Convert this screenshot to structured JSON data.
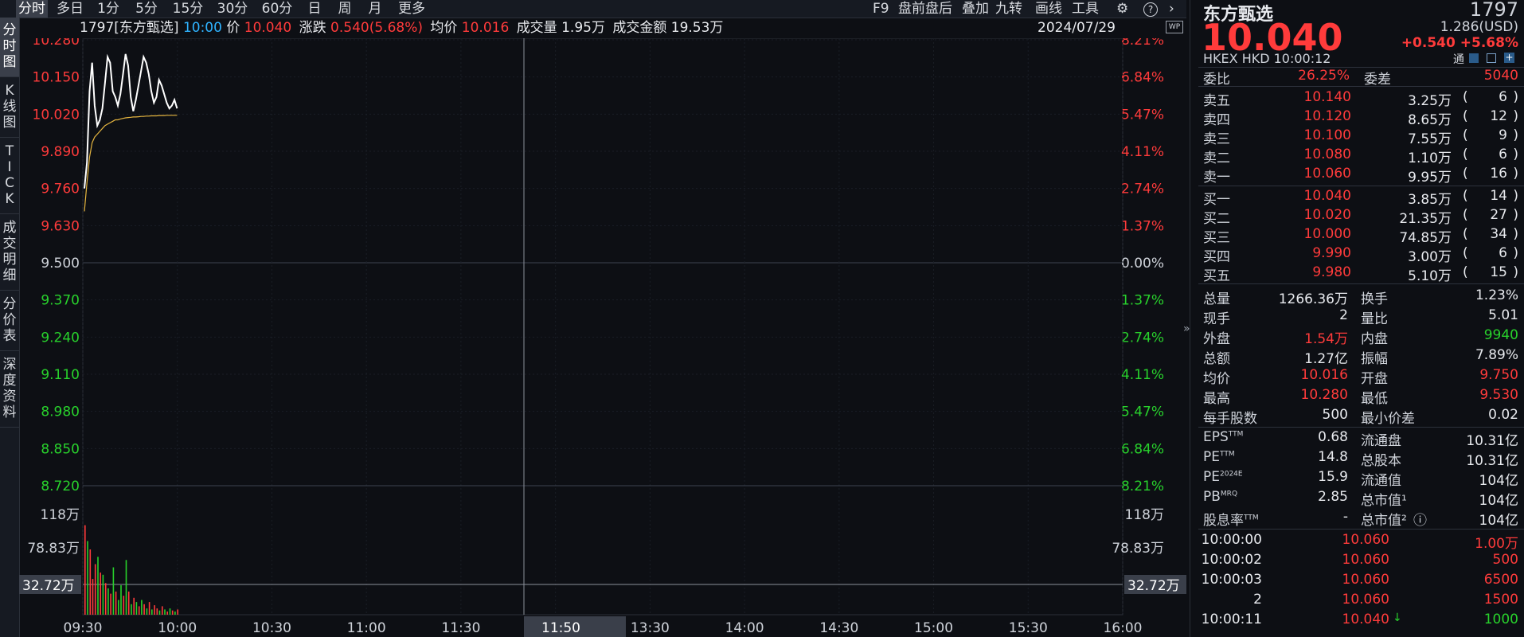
{
  "toolbar": {
    "left_tabs": [
      "分时",
      "多日",
      "1分",
      "5分",
      "15分",
      "30分",
      "60分",
      "日",
      "周",
      "月",
      "更多"
    ],
    "active_tab": "分时",
    "right_items": [
      "F9",
      "盘前盘后",
      "叠加",
      "九转",
      "画线",
      "工具"
    ],
    "gear_icon": "gear-icon",
    "help_icon": "help-icon",
    "expand_icon": "chevron-right-icon"
  },
  "side_tabs": [
    "分时图",
    "K线图",
    "TICK",
    "成交明细",
    "分价表",
    "深度资料"
  ],
  "info_bar": {
    "code_name": "1797[东方甄选]",
    "time": "10:00",
    "price_label": "价",
    "price": "10.040",
    "change_label": "涨跌",
    "change": "0.540(5.68%)",
    "avg_label": "均价",
    "avg": "10.016",
    "vol_label": "成交量",
    "vol": "1.95万",
    "amount_label": "成交金额",
    "amount": "19.53万",
    "date": "2024/07/29",
    "wp_badge": "WP"
  },
  "chart_data": {
    "type": "line",
    "x_ticks": [
      "09:30",
      "10:00",
      "10:30",
      "11:00",
      "11:30",
      "11:50",
      "13:30",
      "14:00",
      "14:30",
      "15:00",
      "15:30",
      "16:00"
    ],
    "price_ticks": [
      "10.280",
      "10.150",
      "10.020",
      "9.890",
      "9.760",
      "9.630",
      "9.500",
      "9.370",
      "9.240",
      "9.110",
      "8.980",
      "8.850",
      "8.720"
    ],
    "pct_ticks": [
      "8.21%",
      "6.84%",
      "5.47%",
      "4.11%",
      "2.74%",
      "1.37%",
      "0.00%",
      "1.37%",
      "2.74%",
      "4.11%",
      "5.47%",
      "6.84%",
      "8.21%"
    ],
    "prev_close": 9.5,
    "ylim": [
      8.72,
      10.28
    ],
    "vol_ticks": [
      "118万",
      "78.83万",
      "32.72万"
    ],
    "cursor_time_label": "11:50",
    "cursor_vol_label": "32.72万",
    "series": [
      {
        "name": "price",
        "color": "#ffffff",
        "values": [
          9.76,
          9.85,
          10.1,
          10.2,
          10.05,
          9.98,
          10.0,
          10.04,
          10.13,
          10.22,
          10.2,
          10.1,
          10.08,
          10.05,
          10.09,
          10.16,
          10.23,
          10.19,
          10.08,
          10.03,
          10.07,
          10.12,
          10.17,
          10.22,
          10.2,
          10.16,
          10.1,
          10.06,
          10.08,
          10.14,
          10.12,
          10.09,
          10.06,
          10.04,
          10.05,
          10.07,
          10.04
        ]
      },
      {
        "name": "avg",
        "color": "#e6b640",
        "values": [
          9.68,
          9.78,
          9.87,
          9.92,
          9.94,
          9.95,
          9.96,
          9.97,
          9.98,
          9.985,
          9.99,
          9.995,
          10.0,
          10.0,
          10.003,
          10.005,
          10.007,
          10.008,
          10.009,
          10.01,
          10.01,
          10.011,
          10.012,
          10.012,
          10.013,
          10.013,
          10.014,
          10.014,
          10.014,
          10.015,
          10.015,
          10.015,
          10.016,
          10.016,
          10.016,
          10.016,
          10.016
        ]
      }
    ],
    "volume": {
      "max": 118,
      "values": [
        85,
        70,
        62,
        34,
        48,
        55,
        40,
        38,
        30,
        25,
        20,
        45,
        22,
        14,
        28,
        18,
        52,
        22,
        10,
        16,
        12,
        8,
        14,
        10,
        6,
        12,
        5,
        9,
        6,
        4,
        8,
        5,
        3,
        6,
        4,
        3,
        5
      ],
      "up": [
        false,
        true,
        false,
        false,
        false,
        true,
        false,
        true,
        false,
        true,
        false,
        true,
        false,
        true,
        true,
        false,
        true,
        false,
        true,
        false,
        true,
        false,
        true,
        false,
        true,
        false,
        true,
        false,
        false,
        true,
        false,
        true,
        false,
        true,
        false,
        true,
        false
      ]
    }
  },
  "quote": {
    "name": "东方甄选",
    "code": "1797",
    "price": "10.040",
    "usd": "1.286(USD)",
    "change": "+0.540",
    "change_pct": "+5.68%",
    "market": "HKEX",
    "currency": "HKD",
    "time": "10:00:12",
    "tong": "通",
    "ratio_label": "委比",
    "ratio": "26.25%",
    "diff_label": "委差",
    "diff": "5040"
  },
  "asks": [
    {
      "label": "卖五",
      "price": "10.140",
      "vol": "3.25万",
      "count": "6"
    },
    {
      "label": "卖四",
      "price": "10.120",
      "vol": "8.65万",
      "count": "12"
    },
    {
      "label": "卖三",
      "price": "10.100",
      "vol": "7.55万",
      "count": "9"
    },
    {
      "label": "卖二",
      "price": "10.080",
      "vol": "1.10万",
      "count": "6"
    },
    {
      "label": "卖一",
      "price": "10.060",
      "vol": "9.95万",
      "count": "16"
    }
  ],
  "bids": [
    {
      "label": "买一",
      "price": "10.040",
      "vol": "3.85万",
      "count": "14"
    },
    {
      "label": "买二",
      "price": "10.020",
      "vol": "21.35万",
      "count": "27"
    },
    {
      "label": "买三",
      "price": "10.000",
      "vol": "74.85万",
      "count": "34"
    },
    {
      "label": "买四",
      "price": "9.990",
      "vol": "3.00万",
      "count": "6"
    },
    {
      "label": "买五",
      "price": "9.980",
      "vol": "5.10万",
      "count": "15"
    }
  ],
  "stats": [
    {
      "l1": "总量",
      "v1": "1266.36万",
      "c1": "w",
      "l2": "换手",
      "v2": "1.23%",
      "c2": "w"
    },
    {
      "l1": "现手",
      "v1": "2",
      "c1": "w",
      "l2": "量比",
      "v2": "5.01",
      "c2": "w"
    },
    {
      "l1": "外盘",
      "v1": "1.54万",
      "c1": "r",
      "l2": "内盘",
      "v2": "9940",
      "c2": "g"
    },
    {
      "l1": "总额",
      "v1": "1.27亿",
      "c1": "w",
      "l2": "振幅",
      "v2": "7.89%",
      "c2": "w"
    },
    {
      "l1": "均价",
      "v1": "10.016",
      "c1": "r",
      "l2": "开盘",
      "v2": "9.750",
      "c2": "r"
    },
    {
      "l1": "最高",
      "v1": "10.280",
      "c1": "r",
      "l2": "最低",
      "v2": "9.530",
      "c2": "r"
    },
    {
      "l1": "每手股数",
      "v1": "500",
      "c1": "w",
      "l2": "最小价差",
      "v2": "0.02",
      "c2": "w"
    }
  ],
  "fund": [
    {
      "l1": "EPS",
      "s1": "TTM",
      "v1": "0.68",
      "l2": "流通盘",
      "v2": "10.31亿"
    },
    {
      "l1": "PE",
      "s1": "TTM",
      "v1": "14.8",
      "l2": "总股本",
      "v2": "10.31亿"
    },
    {
      "l1": "PE",
      "s1": "2024E",
      "v1": "15.9",
      "l2": "流通值",
      "v2": "104亿"
    },
    {
      "l1": "PB",
      "s1": "MRQ",
      "v1": "2.85",
      "l2": "总市值¹",
      "v2": "104亿"
    },
    {
      "l1": "股息率",
      "s1": "TTM",
      "v1": "-",
      "l2": "总市值²",
      "v2": "104亿"
    }
  ],
  "ticks": [
    {
      "time": "10:00:00",
      "price": "10.060",
      "vol": "1.00万",
      "arrow": ""
    },
    {
      "time": "10:00:02",
      "price": "10.060",
      "vol": "500",
      "arrow": ""
    },
    {
      "time": "10:00:03",
      "price": "10.060",
      "vol": "6500",
      "arrow": ""
    },
    {
      "time": "2",
      "price": "10.060",
      "vol": "1500",
      "arrow": ""
    },
    {
      "time": "10:00:11",
      "price": "10.040",
      "vol": "1000",
      "arrow": "↓"
    }
  ]
}
